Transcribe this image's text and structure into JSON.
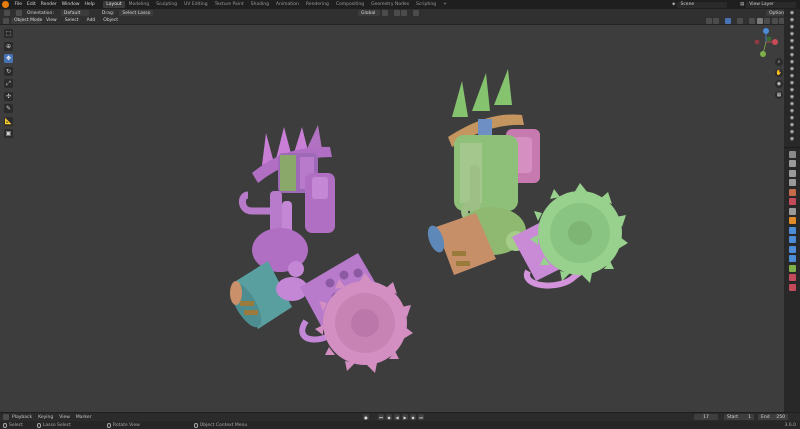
{
  "menu": [
    "File",
    "Edit",
    "Render",
    "Window",
    "Help"
  ],
  "workspaces": [
    "Layout",
    "Modeling",
    "Sculpting",
    "UV Editing",
    "Texture Paint",
    "Shading",
    "Animation",
    "Rendering",
    "Compositing",
    "Geometry Nodes",
    "Scripting",
    "+"
  ],
  "scene": {
    "name": "Scene"
  },
  "view_layer": {
    "name": "View Layer"
  },
  "header": {
    "orientation_label": "Orientation:",
    "orientation_value": "Default",
    "drag_label": "Drag:",
    "drag_value": "Select Lasso",
    "transform_space": "Global",
    "options_label": "Options"
  },
  "header2": {
    "mode": "Object Mode",
    "view": "View",
    "select": "Select",
    "add": "Add",
    "object": "Object"
  },
  "tools": [
    "cursor-select",
    "cursor-3d",
    "move",
    "rotate",
    "scale",
    "transform",
    "annotate",
    "measure",
    "add-cube"
  ],
  "timeline": {
    "playback": "Playback",
    "keying": "Keying",
    "view": "View",
    "marker": "Marker",
    "current_frame": "17",
    "start_label": "Start",
    "start": "1",
    "end_label": "End",
    "end": "250"
  },
  "status": {
    "select": "Select",
    "lasso": "Lasso Select",
    "rotate": "Rotate View",
    "context_menu": "Object Context Menu",
    "version": "3.6.0"
  },
  "colors": {
    "accent": "#4772b3",
    "pink_model": "#d18ad8",
    "green_model": "#8fc77a"
  }
}
